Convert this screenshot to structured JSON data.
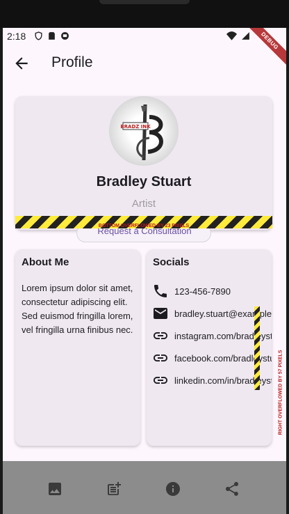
{
  "status_bar": {
    "time": "2:18",
    "debug": "DEBUG"
  },
  "app_bar": {
    "title": "Profile",
    "back_icon": "arrow-back-icon"
  },
  "profile": {
    "name": "Bradley Stuart",
    "role": "Artist",
    "logo_text": "BRADZ INK",
    "consult_label": "Request a Consultation",
    "overflow_banner": "BOTTOM OVERFLOWED BY 23 PIXELS"
  },
  "about": {
    "title": "About Me",
    "text": "Lorem ipsum dolor sit amet, consectetur adipiscing elit. Sed euismod fringilla lorem, vel fringilla urna finibus nec."
  },
  "socials": {
    "title": "Socials",
    "items": [
      {
        "icon": "phone-icon",
        "text": "123-456-7890"
      },
      {
        "icon": "email-icon",
        "text": "bradley.stuart@example.com"
      },
      {
        "icon": "link-icon",
        "text": "instagram.com/bradleystuart"
      },
      {
        "icon": "link-icon",
        "text": "facebook.com/bradleystuart"
      },
      {
        "icon": "link-icon",
        "text": "linkedin.com/in/bradleystuart"
      }
    ],
    "overflow_banner": "RIGHT OVERFLOWED BY 57 PIXELS"
  },
  "bottom_nav": {
    "items": [
      {
        "icon": "image-icon"
      },
      {
        "icon": "post-add-icon"
      },
      {
        "icon": "info-icon"
      },
      {
        "icon": "share-icon"
      }
    ]
  },
  "colors": {
    "background": "#fdf7fd",
    "card": "#efe8f1",
    "accent": "#6750a4",
    "nav": "#8c8c8c"
  }
}
